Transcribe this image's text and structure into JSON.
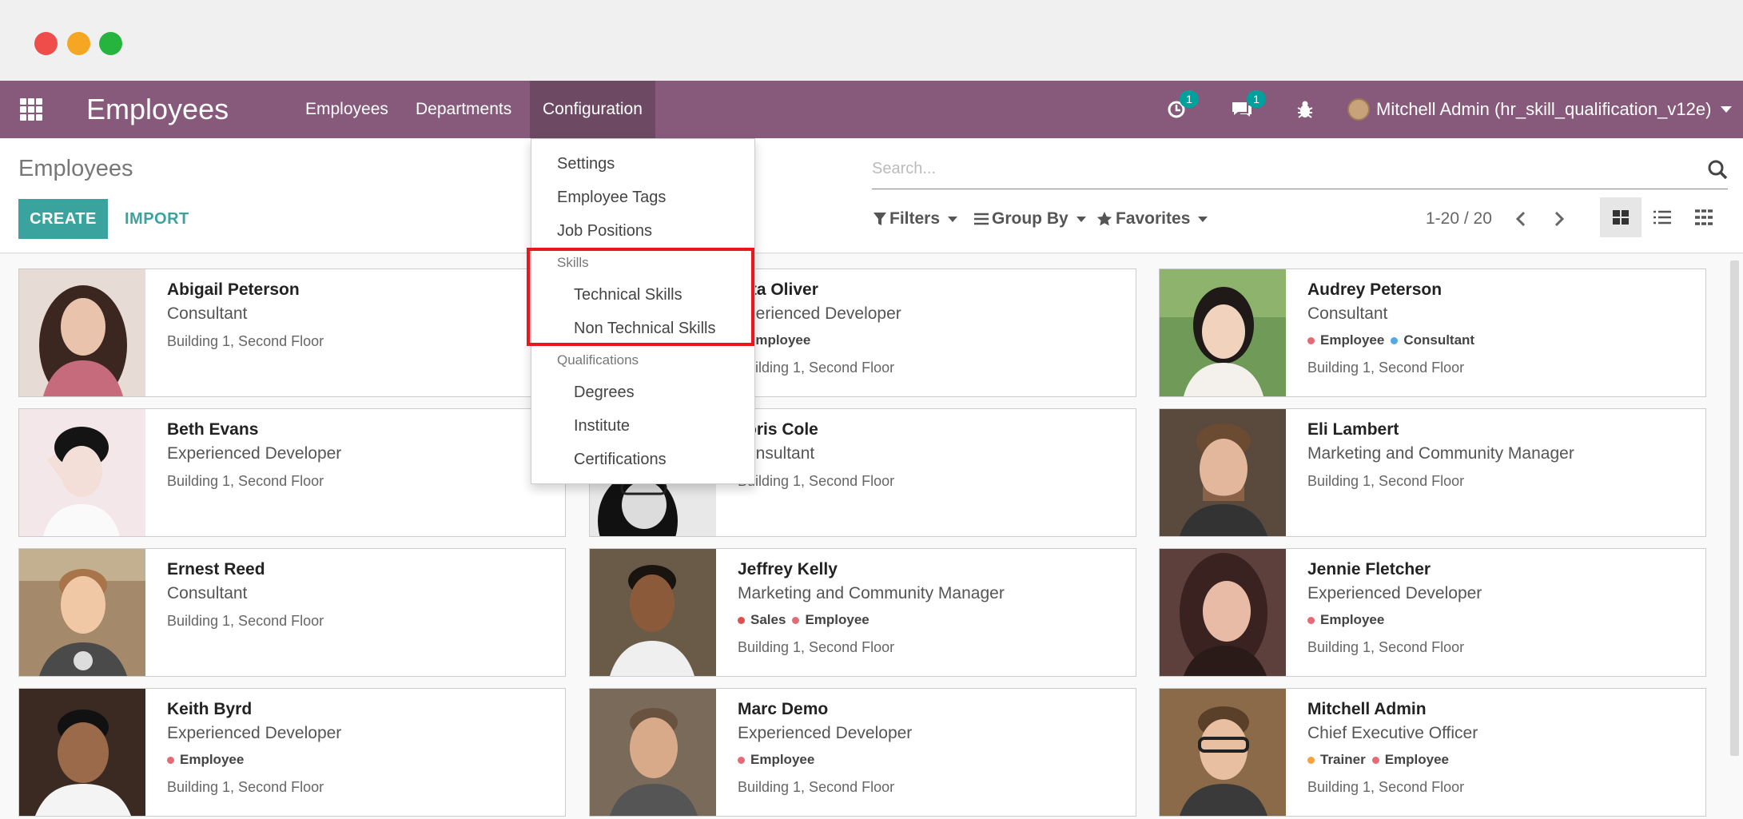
{
  "navbar": {
    "brand": "Employees",
    "menu": [
      "Employees",
      "Departments",
      "Configuration"
    ],
    "activity_count": "1",
    "messages_count": "1",
    "user_name": "Mitchell Admin (hr_skill_qualification_v12e)",
    "color": "#875a7b"
  },
  "control": {
    "breadcrumb": "Employees",
    "create_label": "CREATE",
    "import_label": "IMPORT",
    "search_placeholder": "Search...",
    "filters_label": "Filters",
    "groupby_label": "Group By",
    "favorites_label": "Favorites",
    "pager": "1-20 / 20",
    "accent": "#3aa39e"
  },
  "config_menu": {
    "settings": "Settings",
    "employee_tags": "Employee Tags",
    "job_positions": "Job Positions",
    "skills_header": "Skills",
    "technical_skills": "Technical Skills",
    "non_technical_skills": "Non Technical Skills",
    "qualifications_header": "Qualifications",
    "degrees": "Degrees",
    "institute": "Institute",
    "certifications": "Certifications"
  },
  "cards": [
    {
      "name": "Abigail Peterson",
      "job": "Consultant",
      "tags": [],
      "location": "Building 1, Second Floor"
    },
    {
      "name": "ita Oliver",
      "job": "perienced Developer",
      "tags": [
        {
          "label": "Employee",
          "color": "#e46a76"
        }
      ],
      "location": "Building 1, Second Floor"
    },
    {
      "name": "Audrey Peterson",
      "job": "Consultant",
      "tags": [
        {
          "label": "Employee",
          "color": "#e46a76"
        },
        {
          "label": "Consultant",
          "color": "#56a8e3"
        }
      ],
      "location": "Building 1, Second Floor"
    },
    {
      "name": "Beth Evans",
      "job": "Experienced Developer",
      "tags": [],
      "location": "Building 1, Second Floor"
    },
    {
      "name": "oris Cole",
      "job": "onsultant",
      "tags": [],
      "location": "Building 1, Second Floor"
    },
    {
      "name": "Eli Lambert",
      "job": "Marketing and Community Manager",
      "tags": [],
      "location": "Building 1, Second Floor"
    },
    {
      "name": "Ernest Reed",
      "job": "Consultant",
      "tags": [],
      "location": "Building 1, Second Floor"
    },
    {
      "name": "Jeffrey Kelly",
      "job": "Marketing and Community Manager",
      "tags": [
        {
          "label": "Sales",
          "color": "#e14e4e"
        },
        {
          "label": "Employee",
          "color": "#e46a76"
        }
      ],
      "location": "Building 1, Second Floor"
    },
    {
      "name": "Jennie Fletcher",
      "job": "Experienced Developer",
      "tags": [
        {
          "label": "Employee",
          "color": "#e46a76"
        }
      ],
      "location": "Building 1, Second Floor"
    },
    {
      "name": "Keith Byrd",
      "job": "Experienced Developer",
      "tags": [
        {
          "label": "Employee",
          "color": "#e46a76"
        }
      ],
      "location": "Building 1, Second Floor"
    },
    {
      "name": "Marc Demo",
      "job": "Experienced Developer",
      "tags": [
        {
          "label": "Employee",
          "color": "#e46a76"
        }
      ],
      "location": "Building 1, Second Floor"
    },
    {
      "name": "Mitchell Admin",
      "job": "Chief Executive Officer",
      "tags": [
        {
          "label": "Trainer",
          "color": "#f4a340"
        },
        {
          "label": "Employee",
          "color": "#e46a76"
        }
      ],
      "location": "Building 1, Second Floor"
    }
  ]
}
